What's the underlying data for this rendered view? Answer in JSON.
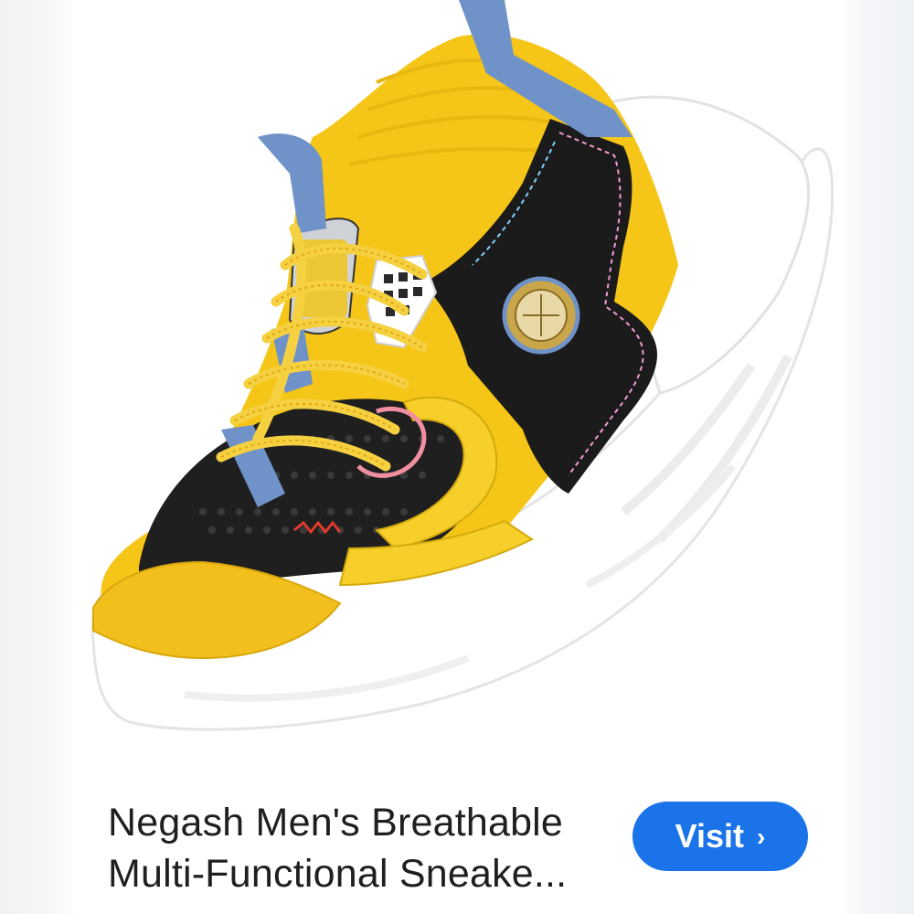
{
  "product": {
    "image_icon": "sneaker-product-photo",
    "title_lines": [
      "Negash Men's Breathable",
      "Multi-Functional Sneake..."
    ]
  },
  "visit_button": {
    "label": "Visit",
    "chevron": "›"
  },
  "colors": {
    "accent": "#1a73e8",
    "shoe_yellow": "#f5c518",
    "shoe_black": "#1b1b1b",
    "strap_blue": "#6f93c8",
    "sole_white": "#ffffff"
  }
}
